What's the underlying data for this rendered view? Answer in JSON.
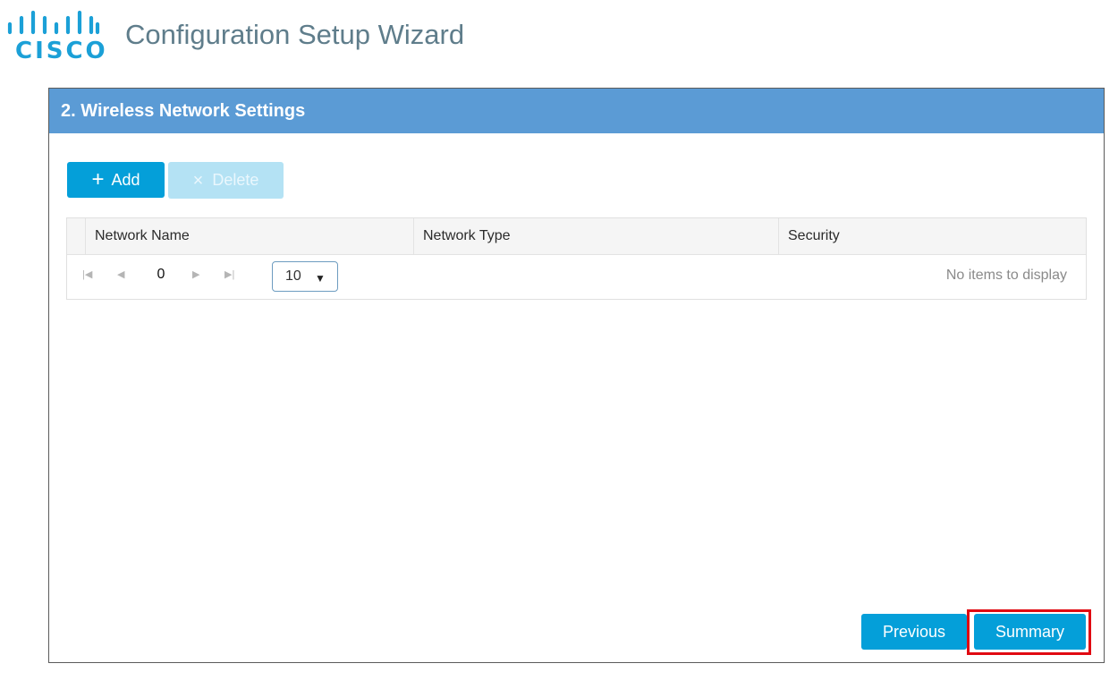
{
  "app": {
    "logo_text": "CISCO",
    "title": "Configuration Setup Wizard"
  },
  "colors": {
    "logo": "#1ba0d7",
    "panel_header": "#5b9bd5",
    "primary_button": "#049fd9",
    "disabled_button": "#b4e2f4",
    "highlight": "#e00a12"
  },
  "panel": {
    "title": "2. Wireless Network Settings"
  },
  "toolbar": {
    "add_icon": "plus-icon",
    "add_label": "Add",
    "delete_icon": "close-icon",
    "delete_label": "Delete"
  },
  "grid": {
    "columns": [
      "Network Name",
      "Network Type",
      "Security"
    ],
    "rows": [],
    "pager": {
      "page_number": "0",
      "page_size": "10",
      "empty_message": "No items to display"
    }
  },
  "footer": {
    "previous_label": "Previous",
    "summary_label": "Summary"
  }
}
